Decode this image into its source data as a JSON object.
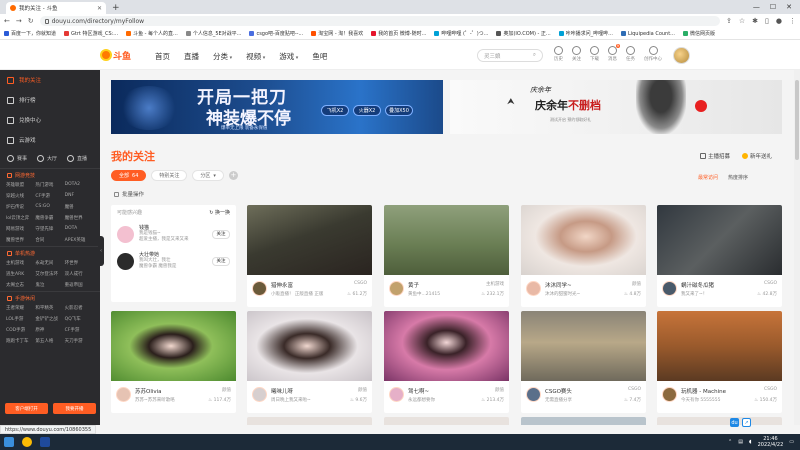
{
  "browser": {
    "tab_title": "我的关注 - 斗鱼",
    "url": "douyu.com/directory/myFollow",
    "status_url": "https://www.douyu.com/10860355",
    "bookmarks": [
      {
        "label": "百度一下，你就知道",
        "color": "#2a5bd7"
      },
      {
        "label": "Gtrt 特区游戏_CS:...",
        "color": "#e53935"
      },
      {
        "label": "斗鱼 - 每个人的直...",
        "color": "#ff6a00"
      },
      {
        "label": "个人信息_5E对战平...",
        "color": "#888888"
      },
      {
        "label": "csgo吧-百度贴吧--...",
        "color": "#4a6ee0"
      },
      {
        "label": "淘宝网 - 淘！我喜欢",
        "color": "#ff5000"
      },
      {
        "label": "我的首页 微博-随时...",
        "color": "#e6162d"
      },
      {
        "label": "哔哩哔哩 (゜-゜)つ...",
        "color": "#00a1d6"
      },
      {
        "label": "奥加(IO.COM) - 正...",
        "color": "#555555"
      },
      {
        "label": "咔咔播求问_哔哩哔...",
        "color": "#00a1d6"
      },
      {
        "label": "Liquipedia Count...",
        "color": "#2f6db5"
      },
      {
        "label": "微信网页版",
        "color": "#2aae67"
      }
    ]
  },
  "header": {
    "logo_text": "斗鱼",
    "nav": [
      {
        "label": "首页",
        "dropdown": false
      },
      {
        "label": "直播",
        "dropdown": false
      },
      {
        "label": "分类",
        "dropdown": true
      },
      {
        "label": "视频",
        "dropdown": true
      },
      {
        "label": "游戏",
        "dropdown": true
      },
      {
        "label": "鱼吧",
        "dropdown": false
      }
    ],
    "search_placeholder": "灵三娘",
    "icons": [
      {
        "name": "history",
        "label": "历史"
      },
      {
        "name": "follow",
        "label": "关注"
      },
      {
        "name": "download",
        "label": "下载"
      },
      {
        "name": "message",
        "label": "消息",
        "badge": "9"
      },
      {
        "name": "task",
        "label": "任务"
      },
      {
        "name": "creator",
        "label": "创作中心"
      }
    ]
  },
  "sidebar": {
    "items": [
      {
        "label": "我的关注",
        "active": true
      },
      {
        "label": "排行榜",
        "active": false
      },
      {
        "label": "兑换中心",
        "active": false
      },
      {
        "label": "云游戏",
        "active": false
      }
    ],
    "icon_row": [
      {
        "label": "赛事"
      },
      {
        "label": "大厅"
      },
      {
        "label": "直播"
      }
    ],
    "sections": [
      {
        "title": "网游竞技",
        "items": [
          "英雄联盟",
          "热门游戏",
          "DOTA2",
          "穿越火线",
          "CF手游",
          "DNF",
          "炉石传说",
          "CS:GO",
          "魔兽",
          "lol云顶之弈",
          "魔兽争霸",
          "魔兽世界",
          "网易游戏",
          "守望先锋",
          "DOTA",
          "魔兽世界",
          "合同",
          "APEX英雄"
        ]
      },
      {
        "title": "单机热游",
        "items": [
          "主机游戏",
          "永劫无间",
          "环世界",
          "逃生ARK",
          "艾尔登法环",
          "双人成行",
          "太阁立志",
          "鬼泣",
          "重返帝国"
        ]
      },
      {
        "title": "手游休闲",
        "items": [
          "王者荣耀",
          "和平精英",
          "火影忍者",
          "LOL手游",
          "金铲铲之战",
          "QQ飞车",
          "COD手游",
          "原神",
          "CF手游",
          "跑跑卡丁车",
          "第五人格",
          "天刀手游"
        ]
      }
    ],
    "btn_left": "客户端打开",
    "btn_right": "我要开播"
  },
  "banners": {
    "left": {
      "line1": "开局一把刀",
      "line2": "神装爆不停",
      "sub": "爆率无上限 装备永保值",
      "pills": [
        "飞机X2",
        "火器X2",
        "叠加X50"
      ]
    },
    "right": {
      "calligraphy": "庆余年",
      "title_prefix": "庆余年",
      "title_highlight": "不删档",
      "sub": "测试开启 预约领取好礼"
    }
  },
  "page": {
    "title": "我的关注",
    "filters": [
      {
        "label": "全部",
        "count": "64",
        "active": true
      },
      {
        "label": "特别关注",
        "count": "",
        "active": false
      },
      {
        "label": "分区",
        "count": "",
        "active": false,
        "dropdown": true
      }
    ],
    "batch_label": "批量操作",
    "tool_left": "主播招募",
    "tool_right": "新年送礼",
    "sort_on": "最常访问",
    "sort_off": "热度排序"
  },
  "recommend": {
    "title": "可能感兴趣",
    "refresh": "换一换",
    "items": [
      {
        "name": "钱猫",
        "sub1": "我是钱猫~",
        "sub2": "超爱主播，我是又来又来",
        "follow": "关注",
        "avatar": "#f3c0d0"
      },
      {
        "name": "大壮带她",
        "sub1": "我叫大壮，我壮",
        "sub2": "魔兽争霸 魔兽我是",
        "follow": "关注",
        "avatar": "#2b2b2b"
      }
    ]
  },
  "streams": [
    {
      "name": "猎伸永富",
      "category": "CSGO",
      "desc": "小贩直播！ 正版直播 正版",
      "hot": "61.2万",
      "thumb": "fps-dark",
      "avatar": "#6b5a3a"
    },
    {
      "name": "黄子",
      "category": "主机游戏",
      "desc": "黄鱼中...21415",
      "hot": "232.1万",
      "thumb": "field",
      "avatar": "#c2a16c"
    },
    {
      "name": "沐沐同学~",
      "category": "颜值",
      "desc": "沐沐的甜蜜时光~",
      "hot": "4.8万",
      "thumb": "girl-light",
      "avatar": "#e9b9a6"
    },
    {
      "name": "蜗汁磁冬瓜猪",
      "category": "CSGO",
      "desc": "我又来了~！",
      "hot": "42.8万",
      "thumb": "room-dark",
      "avatar": "#4a5a6a"
    },
    {
      "name": "苏苏Olivia",
      "category": "颜值",
      "desc": "苏苏~苏苏来听歌咯",
      "hot": "117.4万",
      "thumb": "girl-green",
      "avatar": "#e6c3b3"
    },
    {
      "name": "曦味儿呀",
      "category": "颜值",
      "desc": "周日晚上我又来啦~",
      "hot": "9.6万",
      "thumb": "girl-white",
      "avatar": "#d7cfcf"
    },
    {
      "name": "驾七啊~",
      "category": "颜值",
      "desc": "永远都想要你",
      "hot": "213.4万",
      "thumb": "girl-pink",
      "avatar": "#e6b0c8"
    },
    {
      "name": "CSGO赛头",
      "category": "CSGO",
      "desc": "无需直播分享",
      "hot": "7.4万",
      "thumb": "map-sand",
      "avatar": "#5a6f8a"
    },
    {
      "name": "玩机器 - Machine",
      "category": "CSGO",
      "desc": "今天有你 5555555",
      "hot": "150.4万",
      "thumb": "map-orange",
      "avatar": "#8c6a3f"
    }
  ],
  "taskbar": {
    "time": "21:46",
    "date": "2022/4/22"
  }
}
